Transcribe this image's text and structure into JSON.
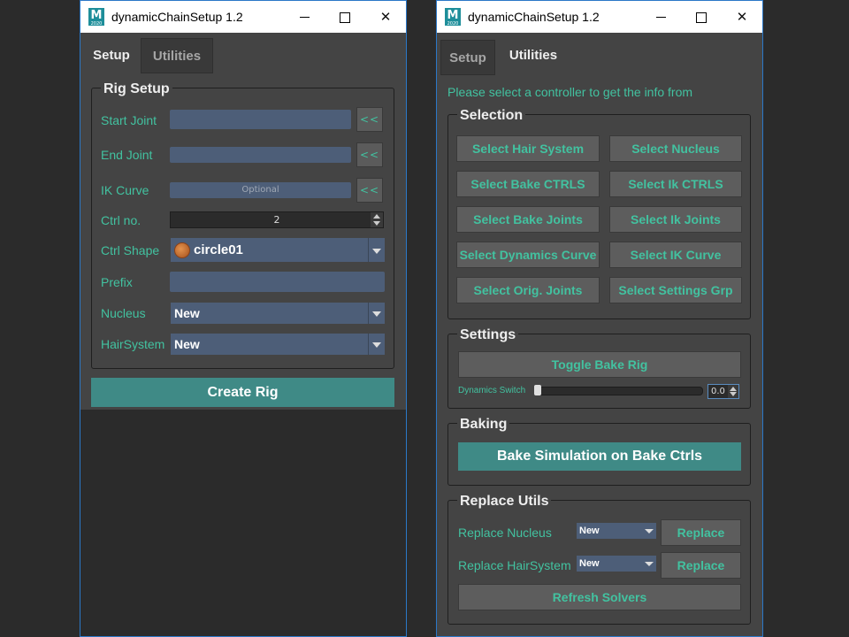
{
  "window_title": "dynamicChainSetup 1.2",
  "app_icon_letter": "M",
  "app_icon_sub": "2020",
  "tabs": {
    "setup": "Setup",
    "utilities": "Utilities"
  },
  "setup": {
    "group_title": "Rig Setup",
    "start_joint_label": "Start Joint",
    "end_joint_label": "End Joint",
    "ik_curve_label": "IK Curve",
    "ik_curve_placeholder": "Optional",
    "pick_label": "<<",
    "ctrl_no_label": "Ctrl no.",
    "ctrl_no_value": "2",
    "ctrl_shape_label": "Ctrl Shape",
    "ctrl_shape_value": "circle01",
    "prefix_label": "Prefix",
    "nucleus_label": "Nucleus",
    "nucleus_value": "New",
    "hairsystem_label": "HairSystem",
    "hairsystem_value": "New",
    "create_button": "Create Rig"
  },
  "utilities": {
    "info_text": "Please select a controller to get the info from",
    "selection_title": "Selection",
    "selection_buttons": [
      "Select Hair System",
      "Select Nucleus",
      "Select Bake CTRLS",
      "Select Ik CTRLS",
      "Select Bake Joints",
      "Select Ik Joints",
      "Select Dynamics Curve",
      "Select IK Curve",
      "Select Orig. Joints",
      "Select Settings Grp"
    ],
    "settings_title": "Settings",
    "toggle_bake_rig": "Toggle Bake Rig",
    "dynamics_switch_label": "Dynamics Switch",
    "dynamics_switch_value": "0.0",
    "dynamics_switch_level": 0.0,
    "baking_title": "Baking",
    "bake_button": "Bake Simulation on Bake Ctrls",
    "replace_title": "Replace Utils",
    "replace_nucleus_label": "Replace Nucleus",
    "replace_nucleus_value": "New",
    "replace_hair_label": "Replace HairSystem",
    "replace_hair_value": "New",
    "replace_button": "Replace",
    "refresh_button": "Refresh Solvers"
  },
  "colors": {
    "accent_text": "#42c2a0",
    "primary_button": "#3f8a86",
    "field_bg": "#4d5e78",
    "window_border": "#2b78c8"
  }
}
